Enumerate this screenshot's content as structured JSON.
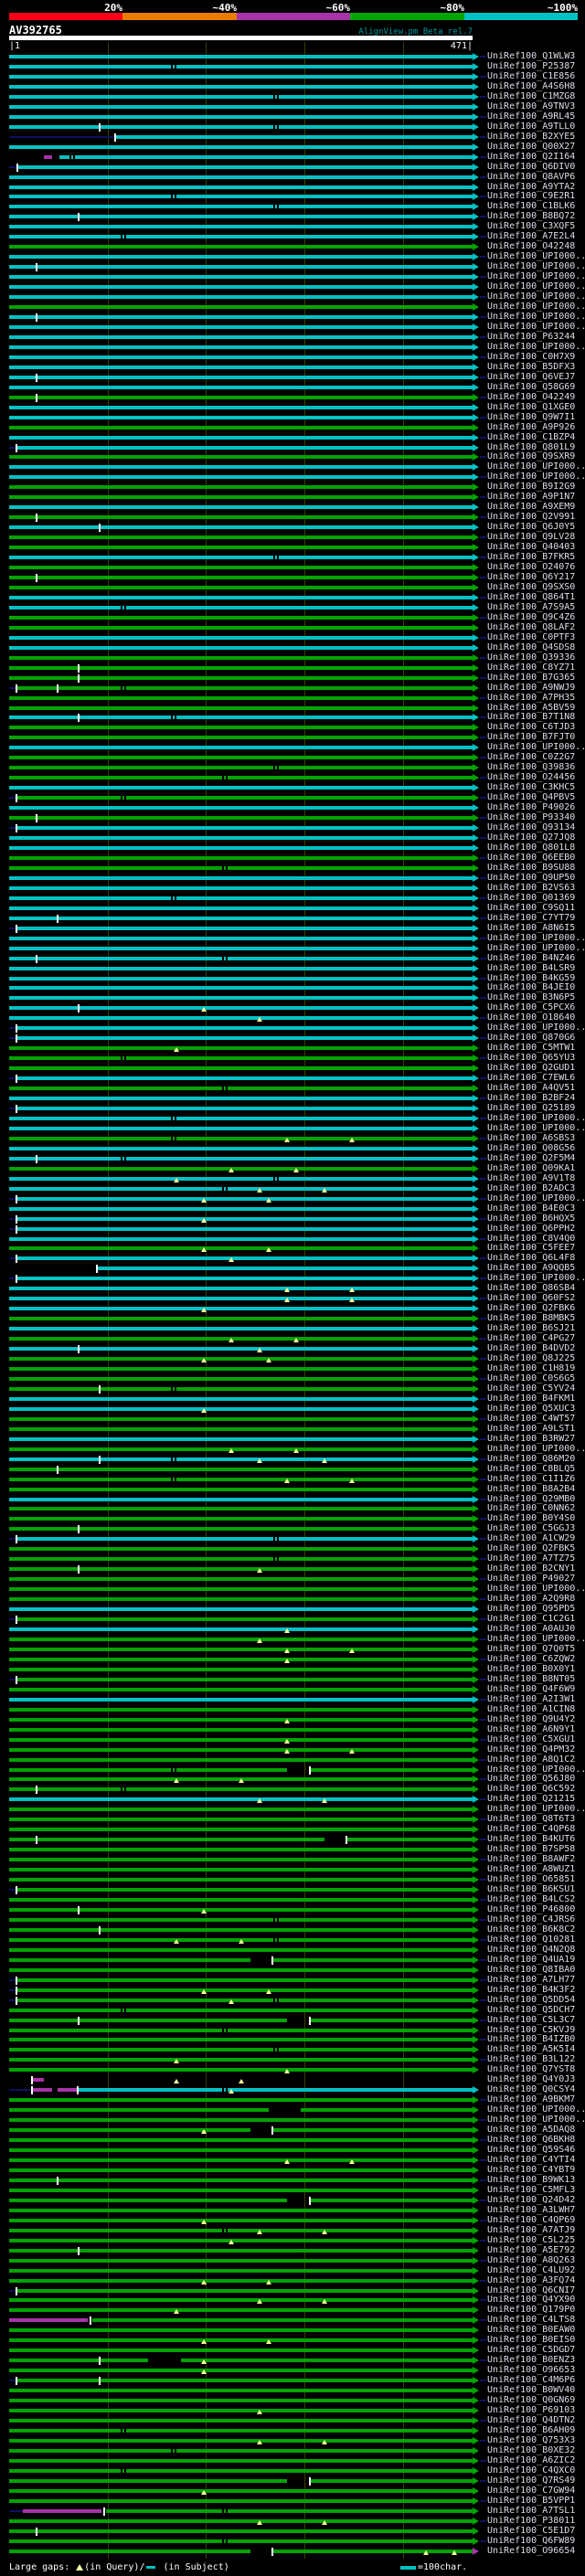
{
  "palette": {
    "background": "#000000",
    "red": "#ff0019",
    "orange": "#e97b00",
    "magenta": "#a833a8",
    "green": "#00a400",
    "cyan": "#00c2c2",
    "navy": "#101060",
    "grid": "#3c3c00",
    "tri": "#ffff9c",
    "white": "#ffffff",
    "label_text": "#dcdce8",
    "title_text": "#009a9a"
  },
  "scale": {
    "segments": [
      {
        "label": "20%",
        "color": "#ff0019"
      },
      {
        "label": "~40%",
        "color": "#e97b00"
      },
      {
        "label": "~60%",
        "color": "#a833a8"
      },
      {
        "label": "~80%",
        "color": "#00a400"
      },
      {
        "label": "~100%",
        "color": "#00c2c2"
      }
    ]
  },
  "header": {
    "query_id": "AV392765",
    "app_title": "AlignView.pm Beta rel.7",
    "ruler_left": "|1",
    "ruler_right": "471|"
  },
  "footer": {
    "prefix": "Large gaps: ",
    "query_text": "(in Query)/",
    "subject_text": " (in Subject)",
    "scale_note": "=100char."
  },
  "chart_data": {
    "type": "bar",
    "orientation": "horizontal",
    "title": "AlignView.pm Beta rel.7",
    "query": {
      "id": "AV392765",
      "start": 1,
      "end": 471,
      "ruler_ticks": [
        100,
        200,
        300,
        400
      ]
    },
    "identity_bins": [
      "20%",
      "~40%",
      "~60%",
      "~80%",
      "~100%"
    ],
    "legend": {
      "c": "~100% identity (cyan)",
      "g": "~80% identity (green)",
      "m": "~60% identity (magenta)"
    },
    "hits": [
      [
        "UniRef100_Q1WLW3",
        "c"
      ],
      [
        "UniRef100_P25387",
        "c"
      ],
      [
        "UniRef100_C1E856",
        "c"
      ],
      [
        "UniRef100_A4S6H8",
        "c"
      ],
      [
        "UniRef100_C1MZG8",
        "c"
      ],
      [
        "UniRef100_A9TNV3",
        "c"
      ],
      [
        "UniRef100_A9RL45",
        "c"
      ],
      [
        "UniRef100_A9TLL0",
        "c"
      ],
      [
        "UniRef100_B2XYE5",
        "c",
        {
          "ld": [
            0,
            0.228
          ],
          "st": 0.228,
          "tk": [
            0.228
          ]
        }
      ],
      [
        "UniRef100_Q00X27",
        "c"
      ],
      [
        "UniRef100_Q2I164",
        "c",
        {
          "sg": [
            [
              0.075,
              0.093,
              "m"
            ],
            [
              0.108,
              1,
              "c"
            ]
          ],
          "cl": [
            0.13
          ]
        }
      ],
      [
        "UniRef100_Q6DIV0",
        "c",
        {
          "ld": [
            0,
            0.018
          ],
          "st": 0.018,
          "tk": [
            0.018
          ]
        }
      ],
      [
        "UniRef100_Q8AVP6",
        "c"
      ],
      [
        "UniRef100_A9YTA2",
        "c"
      ],
      [
        "UniRef100_C9E2R1",
        "c"
      ],
      [
        "UniRef100_C1BLK6",
        "c"
      ],
      [
        "UniRef100_B8BQ72",
        "c"
      ],
      [
        "UniRef100_C3XQF5",
        "c"
      ],
      [
        "UniRef100_A7E2L4",
        "c"
      ],
      [
        "UniRef100_O42248",
        "g"
      ],
      [
        "UniRef100_UPI000..",
        "c"
      ],
      [
        "UniRef100_UPI000..",
        "c"
      ],
      [
        "UniRef100_UPI000..",
        "c"
      ],
      [
        "UniRef100_UPI000..",
        "c"
      ],
      [
        "UniRef100_UPI000..",
        "c"
      ],
      [
        "UniRef100_UPI000..",
        "g"
      ],
      [
        "UniRef100_UPI000..",
        "c"
      ],
      [
        "UniRef100_UPI000..",
        "c"
      ],
      [
        "UniRef100_P63244",
        "c"
      ],
      [
        "UniRef100_UPI000..",
        "c"
      ],
      [
        "UniRef100_C0H7X9",
        "c"
      ],
      [
        "UniRef100_B5DFX3",
        "c"
      ],
      [
        "UniRef100_Q6VEJ7",
        "c"
      ],
      [
        "UniRef100_Q58G69",
        "c"
      ],
      [
        "UniRef100_O42249",
        "g"
      ],
      [
        "UniRef100_Q1XGE0",
        "c"
      ],
      [
        "UniRef100_Q9W7I1",
        "c"
      ],
      [
        "UniRef100_A9P926",
        "g"
      ],
      [
        "UniRef100_C1BZP4",
        "c"
      ],
      [
        "UniRef100_Q801L9",
        "c"
      ],
      [
        "UniRef100_Q9SXR9",
        "g"
      ],
      [
        "UniRef100_UPI000..",
        "c"
      ],
      [
        "UniRef100_UPI000..",
        "c"
      ],
      [
        "UniRef100_B9I2G9",
        "g"
      ],
      [
        "UniRef100_A9P1N7",
        "g"
      ],
      [
        "UniRef100_A9XEM9",
        "c"
      ],
      [
        "UniRef100_Q2V991",
        "g"
      ],
      [
        "UniRef100_Q6J0Y5",
        "c"
      ],
      [
        "UniRef100_Q9LV28",
        "g"
      ],
      [
        "UniRef100_Q40403",
        "g"
      ],
      [
        "UniRef100_B7FKR5",
        "c"
      ],
      [
        "UniRef100_O24076",
        "g"
      ],
      [
        "UniRef100_Q6Y217",
        "g"
      ],
      [
        "UniRef100_Q9SXS0",
        "g"
      ],
      [
        "UniRef100_Q864T1",
        "c"
      ],
      [
        "UniRef100_A7S9A5",
        "c"
      ],
      [
        "UniRef100_Q9C4Z6",
        "g"
      ],
      [
        "UniRef100_Q8LAF2",
        "g"
      ],
      [
        "UniRef100_C0PTF3",
        "c"
      ],
      [
        "UniRef100_Q4SDS8",
        "c"
      ],
      [
        "UniRef100_Q39336",
        "g"
      ],
      [
        "UniRef100_C8YZ71",
        "g"
      ],
      [
        "UniRef100_B7G365",
        "g"
      ],
      [
        "UniRef100_A9NWJ9",
        "g"
      ],
      [
        "UniRef100_A7PH35",
        "g"
      ],
      [
        "UniRef100_A5BV59",
        "g"
      ],
      [
        "UniRef100_B7T1N8",
        "c"
      ],
      [
        "UniRef100_C6TJD3",
        "g"
      ],
      [
        "UniRef100_B7FJT0",
        "g"
      ],
      [
        "UniRef100_UPI000..",
        "c"
      ],
      [
        "UniRef100_C0Z2G7",
        "g"
      ],
      [
        "UniRef100_Q39836",
        "g"
      ],
      [
        "UniRef100_O24456",
        "g"
      ],
      [
        "UniRef100_C3KHC5",
        "c"
      ],
      [
        "UniRef100_Q4PBV5",
        "g"
      ],
      [
        "UniRef100_P49026",
        "c"
      ],
      [
        "UniRef100_P93340",
        "g"
      ],
      [
        "UniRef100_Q93134",
        "c"
      ],
      [
        "UniRef100_Q27JQ8",
        "c"
      ],
      [
        "UniRef100_Q801L8",
        "c"
      ],
      [
        "UniRef100_Q6EEB0",
        "g"
      ],
      [
        "UniRef100_B9SU88",
        "g"
      ],
      [
        "UniRef100_Q9UP50",
        "c"
      ],
      [
        "UniRef100_B2VS63",
        "c"
      ],
      [
        "UniRef100_Q01369",
        "c"
      ],
      [
        "UniRef100_C9SQ11",
        "c"
      ],
      [
        "UniRef100_C7YT79",
        "c"
      ],
      [
        "UniRef100_A8N6I5",
        "c"
      ],
      [
        "UniRef100_UPI000..",
        "c"
      ],
      [
        "UniRef100_UPI000..",
        "c"
      ],
      [
        "UniRef100_B4NZ46",
        "c"
      ],
      [
        "UniRef100_B4LSR9",
        "c"
      ],
      [
        "UniRef100_B4KG59",
        "c"
      ],
      [
        "UniRef100_B4JEI0",
        "c"
      ],
      [
        "UniRef100_B3N6P5",
        "c"
      ],
      [
        "UniRef100_C5PCX6",
        "c"
      ],
      [
        "UniRef100_O18640",
        "c"
      ],
      [
        "UniRef100_UPI000..",
        "c"
      ],
      [
        "UniRef100_Q870G6",
        "c"
      ],
      [
        "UniRef100_C5MTW1",
        "g"
      ],
      [
        "UniRef100_Q65YU3",
        "g"
      ],
      [
        "UniRef100_Q2GUD1",
        "g"
      ],
      [
        "UniRef100_C7EWL6",
        "c"
      ],
      [
        "UniRef100_A4QV51",
        "g"
      ],
      [
        "UniRef100_B2BF24",
        "c"
      ],
      [
        "UniRef100_Q25189",
        "c"
      ],
      [
        "UniRef100_UPI000..",
        "c"
      ],
      [
        "UniRef100_UPI000..",
        "c"
      ],
      [
        "UniRef100_A6SBS3",
        "g"
      ],
      [
        "UniRef100_Q08G56",
        "c"
      ],
      [
        "UniRef100_Q2F5M4",
        "c"
      ],
      [
        "UniRef100_Q09KA1",
        "g"
      ],
      [
        "UniRef100_A9V1T8",
        "c"
      ],
      [
        "UniRef100_B2ADC3",
        "c"
      ],
      [
        "UniRef100_UPI000..",
        "c",
        {
          "ld": [
            0,
            0.015
          ],
          "st": 0.015,
          "tk": [
            0.016
          ]
        }
      ],
      [
        "UniRef100_B4E0C3",
        "c"
      ],
      [
        "UniRef100_B6HQX5",
        "c",
        {
          "ld": [
            0,
            0.015
          ],
          "st": 0.015,
          "tk": [
            0.016
          ]
        }
      ],
      [
        "UniRef100_Q6PPH2",
        "c"
      ],
      [
        "UniRef100_C8V4Q0",
        "c"
      ],
      [
        "UniRef100_C5FEE7",
        "g"
      ],
      [
        "UniRef100_Q6L4F8",
        "c",
        {
          "ld": [
            0,
            0.015
          ],
          "st": 0.015,
          "tk": [
            0.016
          ]
        }
      ],
      [
        "UniRef100_A9QQB5",
        "c",
        {
          "st": 0.19,
          "tk": [
            0.19
          ]
        }
      ],
      [
        "UniRef100_UPI000..",
        "c",
        {
          "ld": [
            0,
            0.015
          ],
          "st": 0.015,
          "tk": [
            0.016
          ]
        }
      ],
      [
        "UniRef100_Q86SB4",
        "c"
      ],
      [
        "UniRef100_Q60FS2",
        "c"
      ],
      [
        "UniRef100_Q2FBK6",
        "c"
      ],
      [
        "UniRef100_B8MBK5",
        "g"
      ],
      [
        "UniRef100_B6SJ21",
        "c"
      ],
      [
        "UniRef100_C4PG27",
        "g"
      ],
      [
        "UniRef100_B4DVD2",
        "c"
      ],
      [
        "UniRef100_Q8J225",
        "g"
      ],
      [
        "UniRef100_C1H819",
        "g"
      ],
      [
        "UniRef100_C0S6G5",
        "g"
      ],
      [
        "UniRef100_C5YV24",
        "g"
      ],
      [
        "UniRef100_B4FKM1",
        "c"
      ],
      [
        "UniRef100_Q5XUC3",
        "c"
      ],
      [
        "UniRef100_C4WT57",
        "g"
      ],
      [
        "UniRef100_A9LST1",
        "g"
      ],
      [
        "UniRef100_B3RW27",
        "c"
      ],
      [
        "UniRef100_UPI000..",
        "g"
      ],
      [
        "UniRef100_Q86M20",
        "c"
      ],
      [
        "UniRef100_C8BLQ5",
        "g"
      ],
      [
        "UniRef100_C1I1Z6",
        "g"
      ],
      [
        "UniRef100_B8A2B4",
        "g"
      ],
      [
        "UniRef100_Q29MB0",
        "c"
      ],
      [
        "UniRef100_C0NN62",
        "g"
      ],
      [
        "UniRef100_B0Y4S0",
        "g"
      ],
      [
        "UniRef100_C5GGJ3",
        "g"
      ],
      [
        "UniRef100_A1CW29",
        "c"
      ],
      [
        "UniRef100_Q2FBK5",
        "g"
      ],
      [
        "UniRef100_A7TZ75",
        "g"
      ],
      [
        "UniRef100_B2CNY1",
        "g"
      ],
      [
        "UniRef100_P49027",
        "g"
      ],
      [
        "UniRef100_UPI000..",
        "g"
      ],
      [
        "UniRef100_A2Q9R8",
        "g"
      ],
      [
        "UniRef100_Q95PD5",
        "c"
      ],
      [
        "UniRef100_C1C2G1",
        "g"
      ],
      [
        "UniRef100_A0AUJ0",
        "c"
      ],
      [
        "UniRef100_UPI000..",
        "g"
      ],
      [
        "UniRef100_Q7Q0T5",
        "g"
      ],
      [
        "UniRef100_C6ZQW2",
        "g"
      ],
      [
        "UniRef100_B0X0Y1",
        "g"
      ],
      [
        "UniRef100_B8NT05",
        "g"
      ],
      [
        "UniRef100_Q4F6W9",
        "g"
      ],
      [
        "UniRef100_A2I3W1",
        "c"
      ],
      [
        "UniRef100_A1CIN8",
        "g"
      ],
      [
        "UniRef100_Q9U4Y2",
        "g"
      ],
      [
        "UniRef100_A6N9Y1",
        "g"
      ],
      [
        "UniRef100_C5XGU1",
        "g"
      ],
      [
        "UniRef100_Q4PM32",
        "g"
      ],
      [
        "UniRef100_A8Q1C2",
        "g"
      ],
      [
        "UniRef100_UPI000..",
        "g"
      ],
      [
        "UniRef100_Q56J80",
        "g"
      ],
      [
        "UniRef100_Q6C592",
        "g"
      ],
      [
        "UniRef100_Q21215",
        "c"
      ],
      [
        "UniRef100_UPI000..",
        "g"
      ],
      [
        "UniRef100_Q8T6T3",
        "g"
      ],
      [
        "UniRef100_C4QP68",
        "g"
      ],
      [
        "UniRef100_B4KUT6",
        "g"
      ],
      [
        "UniRef100_B7SP58",
        "g"
      ],
      [
        "UniRef100_B8AWF2",
        "g"
      ],
      [
        "UniRef100_A8WUZ1",
        "g"
      ],
      [
        "UniRef100_O65851",
        "g"
      ],
      [
        "UniRef100_B6KSU1",
        "g"
      ],
      [
        "UniRef100_B4LCS2",
        "g"
      ],
      [
        "UniRef100_P46800",
        "g"
      ],
      [
        "UniRef100_C4JRS6",
        "g"
      ],
      [
        "UniRef100_B6K8C2",
        "g"
      ],
      [
        "UniRef100_Q10281",
        "g"
      ],
      [
        "UniRef100_Q4N2Q8",
        "g"
      ],
      [
        "UniRef100_Q4UA19",
        "g"
      ],
      [
        "UniRef100_Q8IBA0",
        "g"
      ],
      [
        "UniRef100_A7LH77",
        "g"
      ],
      [
        "UniRef100_B4K3F2",
        "g"
      ],
      [
        "UniRef100_Q5DD54",
        "g"
      ],
      [
        "UniRef100_Q5DCH7",
        "g"
      ],
      [
        "UniRef100_C5L3C7",
        "g"
      ],
      [
        "UniRef100_C5KVJ9",
        "g"
      ],
      [
        "UniRef100_B4IZB0",
        "g"
      ],
      [
        "UniRef100_A5K5I4",
        "g"
      ],
      [
        "UniRef100_B3L122",
        "g"
      ],
      [
        "UniRef100_Q7YST8",
        "g"
      ],
      [
        "UniRef100_Q4Y0J3",
        "m",
        {
          "sg": [
            [
              0.052,
              0.075,
              "m"
            ]
          ],
          "tk": [
            0.05
          ],
          "ar": "none",
          "tl": 0
        }
      ],
      [
        "UniRef100_Q0CSY4",
        "c",
        {
          "ld": [
            0,
            0.05
          ],
          "sg": [
            [
              0.052,
              0.093,
              "m"
            ],
            [
              0.105,
              0.145,
              "m"
            ],
            [
              0.15,
              1,
              "c"
            ]
          ],
          "tk": [
            0.05,
            0.148
          ]
        }
      ],
      [
        "UniRef100_A9BKM7",
        "g"
      ],
      [
        "UniRef100_UPI000..",
        "g",
        {
          "gp": [
            0.56,
            0.63
          ]
        }
      ],
      [
        "UniRef100_UPI000..",
        "g"
      ],
      [
        "UniRef100_A5DAQ8",
        "g"
      ],
      [
        "UniRef100_Q6BKH8",
        "g"
      ],
      [
        "UniRef100_Q59S46",
        "g"
      ],
      [
        "UniRef100_C4YTI4",
        "g"
      ],
      [
        "UniRef100_C4YBT9",
        "g"
      ],
      [
        "UniRef100_B9WK13",
        "g"
      ],
      [
        "UniRef100_C5MFL3",
        "g"
      ],
      [
        "UniRef100_Q24D42",
        "g"
      ],
      [
        "UniRef100_A3LWH7",
        "g"
      ],
      [
        "UniRef100_C4QP69",
        "g"
      ],
      [
        "UniRef100_A7ATJ9",
        "g"
      ],
      [
        "UniRef100_C5L225",
        "g"
      ],
      [
        "UniRef100_A5E792",
        "g"
      ],
      [
        "UniRef100_A8Q263",
        "g"
      ],
      [
        "UniRef100_C4LU92",
        "g"
      ],
      [
        "UniRef100_A3FQ74",
        "g"
      ],
      [
        "UniRef100_Q6CNI7",
        "g"
      ],
      [
        "UniRef100_Q4YX90",
        "g"
      ],
      [
        "UniRef100_Q179P0",
        "g"
      ],
      [
        "UniRef100_C4LTS8",
        "g",
        {
          "sg": [
            [
              0,
              0.17,
              "m"
            ],
            [
              0.18,
              1,
              "g"
            ]
          ],
          "tk": [
            0.175
          ]
        }
      ],
      [
        "UniRef100_B0EAW0",
        "g"
      ],
      [
        "UniRef100_B0EIS0",
        "g"
      ],
      [
        "UniRef100_C5DGD7",
        "g"
      ],
      [
        "UniRef100_B0ENZ3",
        "g",
        {
          "gp": [
            0.3,
            0.37
          ]
        }
      ],
      [
        "UniRef100_O96653",
        "g"
      ],
      [
        "UniRef100_C4M6P6",
        "g"
      ],
      [
        "UniRef100_B0WV40",
        "g"
      ],
      [
        "UniRef100_Q0GN69",
        "g"
      ],
      [
        "UniRef100_P69103",
        "g"
      ],
      [
        "UniRef100_Q4DTN2",
        "g"
      ],
      [
        "UniRef100_B6AH09",
        "g"
      ],
      [
        "UniRef100_Q753X3",
        "g"
      ],
      [
        "UniRef100_B0XE32",
        "g"
      ],
      [
        "UniRef100_A6ZIC2",
        "g"
      ],
      [
        "UniRef100_C4QXC0",
        "g"
      ],
      [
        "UniRef100_Q7RS49",
        "g"
      ],
      [
        "UniRef100_C7GW94",
        "g"
      ],
      [
        "UniRef100_B5VPP1",
        "g"
      ],
      [
        "UniRef100_A7TSL1",
        "g",
        {
          "ld": [
            0,
            0.03
          ],
          "sg": [
            [
              0.03,
              0.2,
              "m"
            ],
            [
              0.21,
              1,
              "g"
            ]
          ],
          "tk": [
            0.205
          ]
        }
      ],
      [
        "UniRef100_P38011",
        "g"
      ],
      [
        "UniRef100_C5E1D7",
        "g"
      ],
      [
        "UniRef100_Q6FW89",
        "g"
      ],
      [
        "UniRef100_O96654",
        "g",
        {
          "ar": "m",
          "tr": [
            0.9,
            0.96
          ]
        }
      ]
    ]
  }
}
